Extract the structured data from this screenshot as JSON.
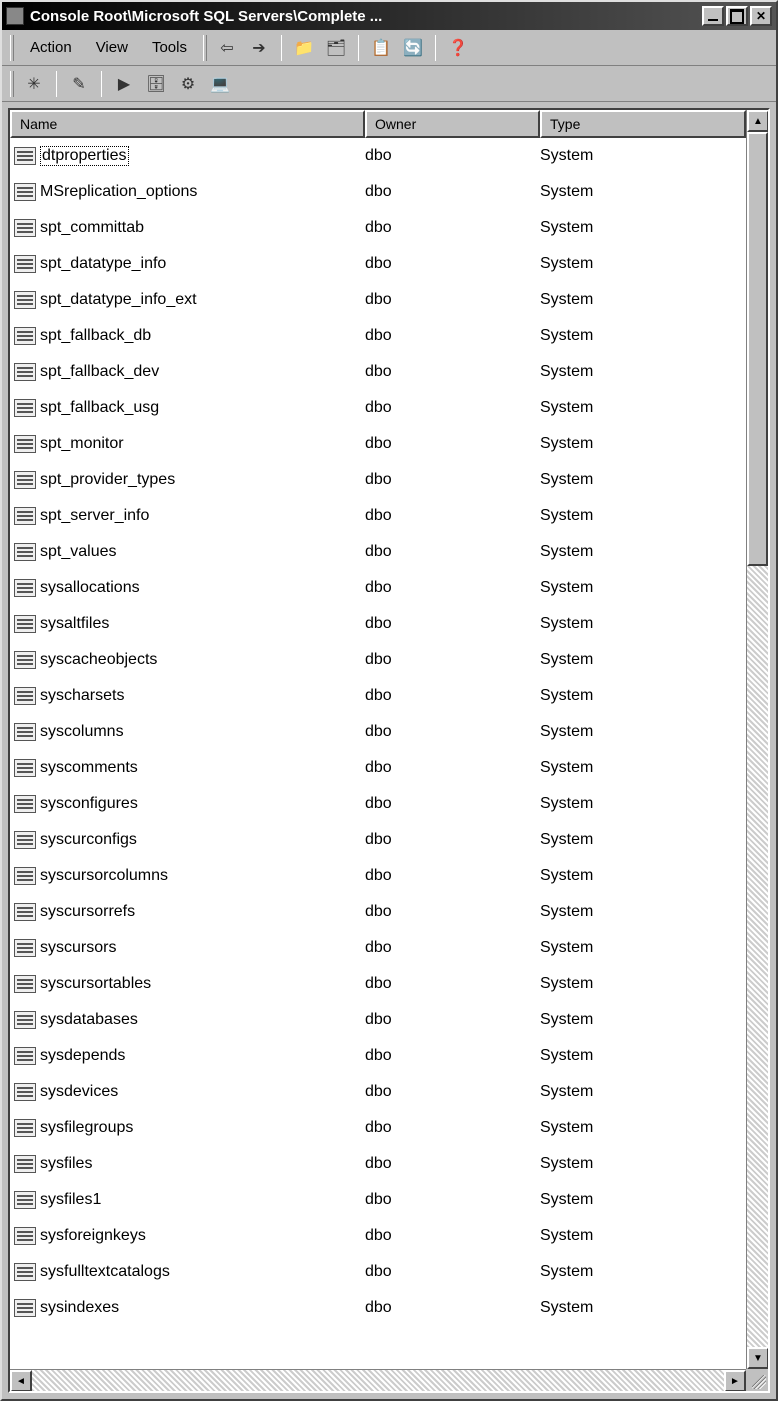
{
  "window": {
    "title": "Console Root\\Microsoft SQL Servers\\Complete ..."
  },
  "menu": {
    "action": "Action",
    "view": "View",
    "tools": "Tools"
  },
  "toolbar_icons": {
    "back": "back-arrow-icon",
    "forward": "forward-arrow-icon",
    "up": "up-folder-icon",
    "show": "list-icon",
    "properties": "properties-icon",
    "refresh": "refresh-icon",
    "help": "help-icon"
  },
  "toolbar2_icons": {
    "new": "new-sparkle-icon",
    "wand": "wand-icon",
    "run": "run-db-icon",
    "db": "database-icon",
    "service": "service-icon",
    "query": "query-icon"
  },
  "columns": {
    "name": "Name",
    "owner": "Owner",
    "type": "Type"
  },
  "rows": [
    {
      "name": "dtproperties",
      "owner": "dbo",
      "type": "System",
      "selected": true
    },
    {
      "name": "MSreplication_options",
      "owner": "dbo",
      "type": "System"
    },
    {
      "name": "spt_committab",
      "owner": "dbo",
      "type": "System"
    },
    {
      "name": "spt_datatype_info",
      "owner": "dbo",
      "type": "System"
    },
    {
      "name": "spt_datatype_info_ext",
      "owner": "dbo",
      "type": "System"
    },
    {
      "name": "spt_fallback_db",
      "owner": "dbo",
      "type": "System"
    },
    {
      "name": "spt_fallback_dev",
      "owner": "dbo",
      "type": "System"
    },
    {
      "name": "spt_fallback_usg",
      "owner": "dbo",
      "type": "System"
    },
    {
      "name": "spt_monitor",
      "owner": "dbo",
      "type": "System"
    },
    {
      "name": "spt_provider_types",
      "owner": "dbo",
      "type": "System"
    },
    {
      "name": "spt_server_info",
      "owner": "dbo",
      "type": "System"
    },
    {
      "name": "spt_values",
      "owner": "dbo",
      "type": "System"
    },
    {
      "name": "sysallocations",
      "owner": "dbo",
      "type": "System"
    },
    {
      "name": "sysaltfiles",
      "owner": "dbo",
      "type": "System"
    },
    {
      "name": "syscacheobjects",
      "owner": "dbo",
      "type": "System"
    },
    {
      "name": "syscharsets",
      "owner": "dbo",
      "type": "System"
    },
    {
      "name": "syscolumns",
      "owner": "dbo",
      "type": "System"
    },
    {
      "name": "syscomments",
      "owner": "dbo",
      "type": "System"
    },
    {
      "name": "sysconfigures",
      "owner": "dbo",
      "type": "System"
    },
    {
      "name": "syscurconfigs",
      "owner": "dbo",
      "type": "System"
    },
    {
      "name": "syscursorcolumns",
      "owner": "dbo",
      "type": "System"
    },
    {
      "name": "syscursorrefs",
      "owner": "dbo",
      "type": "System"
    },
    {
      "name": "syscursors",
      "owner": "dbo",
      "type": "System"
    },
    {
      "name": "syscursortables",
      "owner": "dbo",
      "type": "System"
    },
    {
      "name": "sysdatabases",
      "owner": "dbo",
      "type": "System"
    },
    {
      "name": "sysdepends",
      "owner": "dbo",
      "type": "System"
    },
    {
      "name": "sysdevices",
      "owner": "dbo",
      "type": "System"
    },
    {
      "name": "sysfilegroups",
      "owner": "dbo",
      "type": "System"
    },
    {
      "name": "sysfiles",
      "owner": "dbo",
      "type": "System"
    },
    {
      "name": "sysfiles1",
      "owner": "dbo",
      "type": "System"
    },
    {
      "name": "sysforeignkeys",
      "owner": "dbo",
      "type": "System"
    },
    {
      "name": "sysfulltextcatalogs",
      "owner": "dbo",
      "type": "System"
    },
    {
      "name": "sysindexes",
      "owner": "dbo",
      "type": "System"
    }
  ],
  "scrollbar": {
    "thumb_ratio": 0.55
  }
}
